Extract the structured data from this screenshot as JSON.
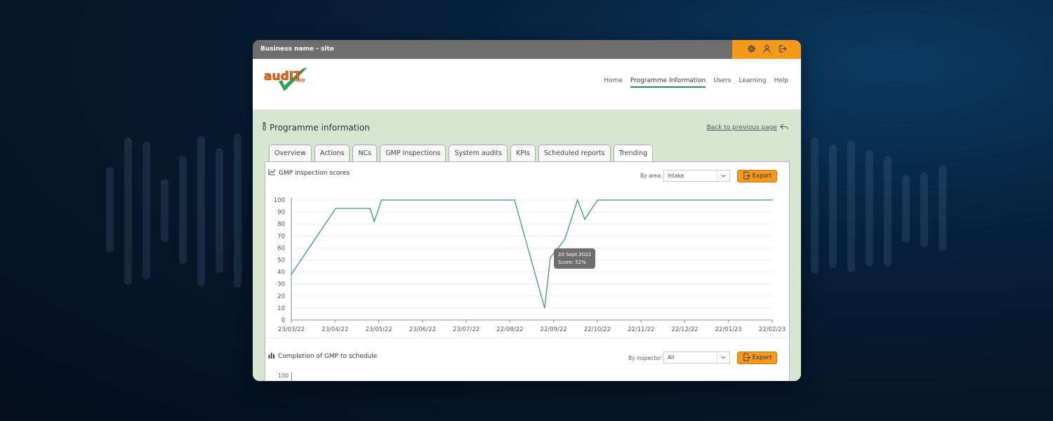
{
  "window": {
    "business_name": "Business name - site",
    "icons": [
      "gear-icon",
      "user-icon",
      "logout-icon"
    ]
  },
  "header": {
    "logo_text": "audIT app",
    "nav": [
      {
        "label": "Home",
        "active": false
      },
      {
        "label": "Programme Information",
        "active": true
      },
      {
        "label": "Users",
        "active": false
      },
      {
        "label": "Learning",
        "active": false
      },
      {
        "label": "Help",
        "active": false
      }
    ]
  },
  "content": {
    "title": "Programme information",
    "back_link": "Back to previous page",
    "tabs": [
      {
        "label": "Overview",
        "active": false
      },
      {
        "label": "Actions",
        "active": false
      },
      {
        "label": "NCs",
        "active": false
      },
      {
        "label": "GMP Inspections",
        "active": false
      },
      {
        "label": "System audits",
        "active": false
      },
      {
        "label": "KPIs",
        "active": false
      },
      {
        "label": "Scheduled reports",
        "active": false
      },
      {
        "label": "Trending",
        "active": true
      }
    ]
  },
  "section1": {
    "title": "GMP inspection scores",
    "filter_label": "By area:",
    "filter_value": "Intake",
    "export_label": "Export"
  },
  "section2": {
    "title": "Completion of GMP to schedule",
    "filter_label": "By inspector:",
    "filter_value": "All",
    "export_label": "Export",
    "y_top_tick": "100"
  },
  "tooltip": {
    "date": "20 Sept 2022",
    "score": "Score: 52%"
  },
  "colors": {
    "accent": "#f39a1d",
    "line": "#3a9a70",
    "content_bg": "#d6e6d1",
    "topbar": "#6e6e6e"
  },
  "chart_data": {
    "type": "line",
    "title": "GMP inspection scores",
    "xlabel": "",
    "ylabel": "",
    "ylim": [
      0,
      100
    ],
    "yticks": [
      0,
      10,
      20,
      30,
      40,
      50,
      60,
      70,
      80,
      90,
      100
    ],
    "xticks": [
      "23/03/22",
      "23/04/22",
      "23/05/22",
      "23/06/22",
      "23/07/22",
      "22/08/22",
      "22/09/22",
      "22/10/22",
      "22/11/22",
      "22/12/22",
      "22/01/23",
      "22/02/23"
    ],
    "grid": true,
    "points": [
      {
        "x": "2022-03-23",
        "y": 38
      },
      {
        "x": "2022-04-23",
        "y": 93
      },
      {
        "x": "2022-05-17",
        "y": 93
      },
      {
        "x": "2022-05-20",
        "y": 82
      },
      {
        "x": "2022-05-25",
        "y": 100
      },
      {
        "x": "2022-08-26",
        "y": 100
      },
      {
        "x": "2022-09-16",
        "y": 10
      },
      {
        "x": "2022-09-20",
        "y": 52
      },
      {
        "x": "2022-09-30",
        "y": 67
      },
      {
        "x": "2022-10-09",
        "y": 100
      },
      {
        "x": "2022-10-14",
        "y": 84
      },
      {
        "x": "2022-10-23",
        "y": 100
      },
      {
        "x": "2023-02-22",
        "y": 100
      }
    ]
  }
}
